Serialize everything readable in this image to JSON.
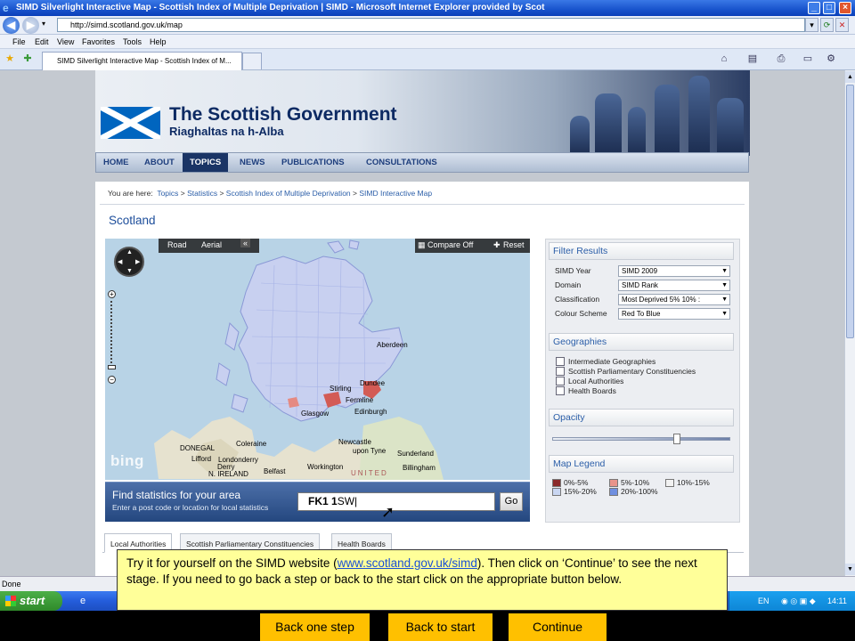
{
  "window": {
    "title": "SIMD Silverlight Interactive Map - Scottish Index of Multiple Deprivation | SIMD - Microsoft Internet Explorer provided by Scot",
    "address": "http://simd.scotland.gov.uk/map",
    "menu": [
      "File",
      "Edit",
      "View",
      "Favorites",
      "Tools",
      "Help"
    ],
    "tab_title": "SIMD Silverlight Interactive Map - Scottish Index of M...",
    "status": "Done"
  },
  "site": {
    "title": "The Scottish Government",
    "subtitle": "Riaghaltas na h-Alba",
    "nav": [
      "HOME",
      "ABOUT",
      "TOPICS",
      "NEWS",
      "PUBLICATIONS",
      "CONSULTATIONS"
    ],
    "breadcrumb": {
      "prefix": "You are here:",
      "items": [
        "Topics",
        "Statistics",
        "Scottish Index of Multiple Deprivation",
        "SIMD Interactive Map"
      ]
    },
    "page_title": "Scotland"
  },
  "map": {
    "road_label": "Road",
    "aerial_label": "Aerial",
    "collapse_label": "«",
    "compare_label": "Compare Off",
    "reset_label": "Reset",
    "brand": "bing",
    "places": [
      "Aberdeen",
      "Dundee",
      "Stirling",
      "Fermline",
      "Edinburgh",
      "Glasgow",
      "Coleraine",
      "DONEGAL",
      "Lifford",
      "Londonderry",
      "Derry",
      "N. IRELAND",
      "Belfast",
      "Workington",
      "upon Tyne",
      "Newcastle",
      "Sunderland",
      "Billingham",
      "UNITED"
    ],
    "find_title": "Find statistics for your area",
    "find_subtitle": "Enter a post code or location for local statistics",
    "postcode_bold": "FK1 1",
    "postcode_rest": "SW",
    "go_label": "Go"
  },
  "filters": {
    "header": "Filter Results",
    "rows": [
      {
        "label": "SIMD Year",
        "value": "SIMD 2009"
      },
      {
        "label": "Domain",
        "value": "SIMD Rank"
      },
      {
        "label": "Classification",
        "value": "Most Deprived 5% 10% :"
      },
      {
        "label": "Colour Scheme",
        "value": "Red To Blue"
      }
    ],
    "geo_header": "Geographies",
    "geographies": [
      "Intermediate Geographies",
      "Scottish Parliamentary Constituencies",
      "Local Authorities",
      "Health Boards"
    ],
    "opacity_header": "Opacity",
    "opacity_level": 0.7,
    "legend_header": "Map Legend",
    "legend": [
      {
        "label": "0%-5%",
        "color": "#8b2a2a"
      },
      {
        "label": "5%-10%",
        "color": "#e8948a"
      },
      {
        "label": "10%-15%",
        "color": "#f2f2f2"
      },
      {
        "label": "15%-20%",
        "color": "#c9d6f2"
      },
      {
        "label": "20%-100%",
        "color": "#6f8fe0"
      }
    ]
  },
  "bottom_tabs": [
    "Local Authorities",
    "Scottish Parliamentary Constituencies",
    "Health Boards"
  ],
  "taskbar": {
    "start": "start",
    "language": "EN",
    "time": "14:11"
  },
  "callout": {
    "text_before": "Try it for yourself on the SIMD website (",
    "link": "www.scotland.gov.uk/simd",
    "text_after": "). Then click on ‘Continue’ to see the next stage. If you need to go back a step or back to the start click on the appropriate button below."
  },
  "nav_buttons": {
    "back_step": "Back one step",
    "back_start": "Back to start",
    "continue": "Continue"
  }
}
